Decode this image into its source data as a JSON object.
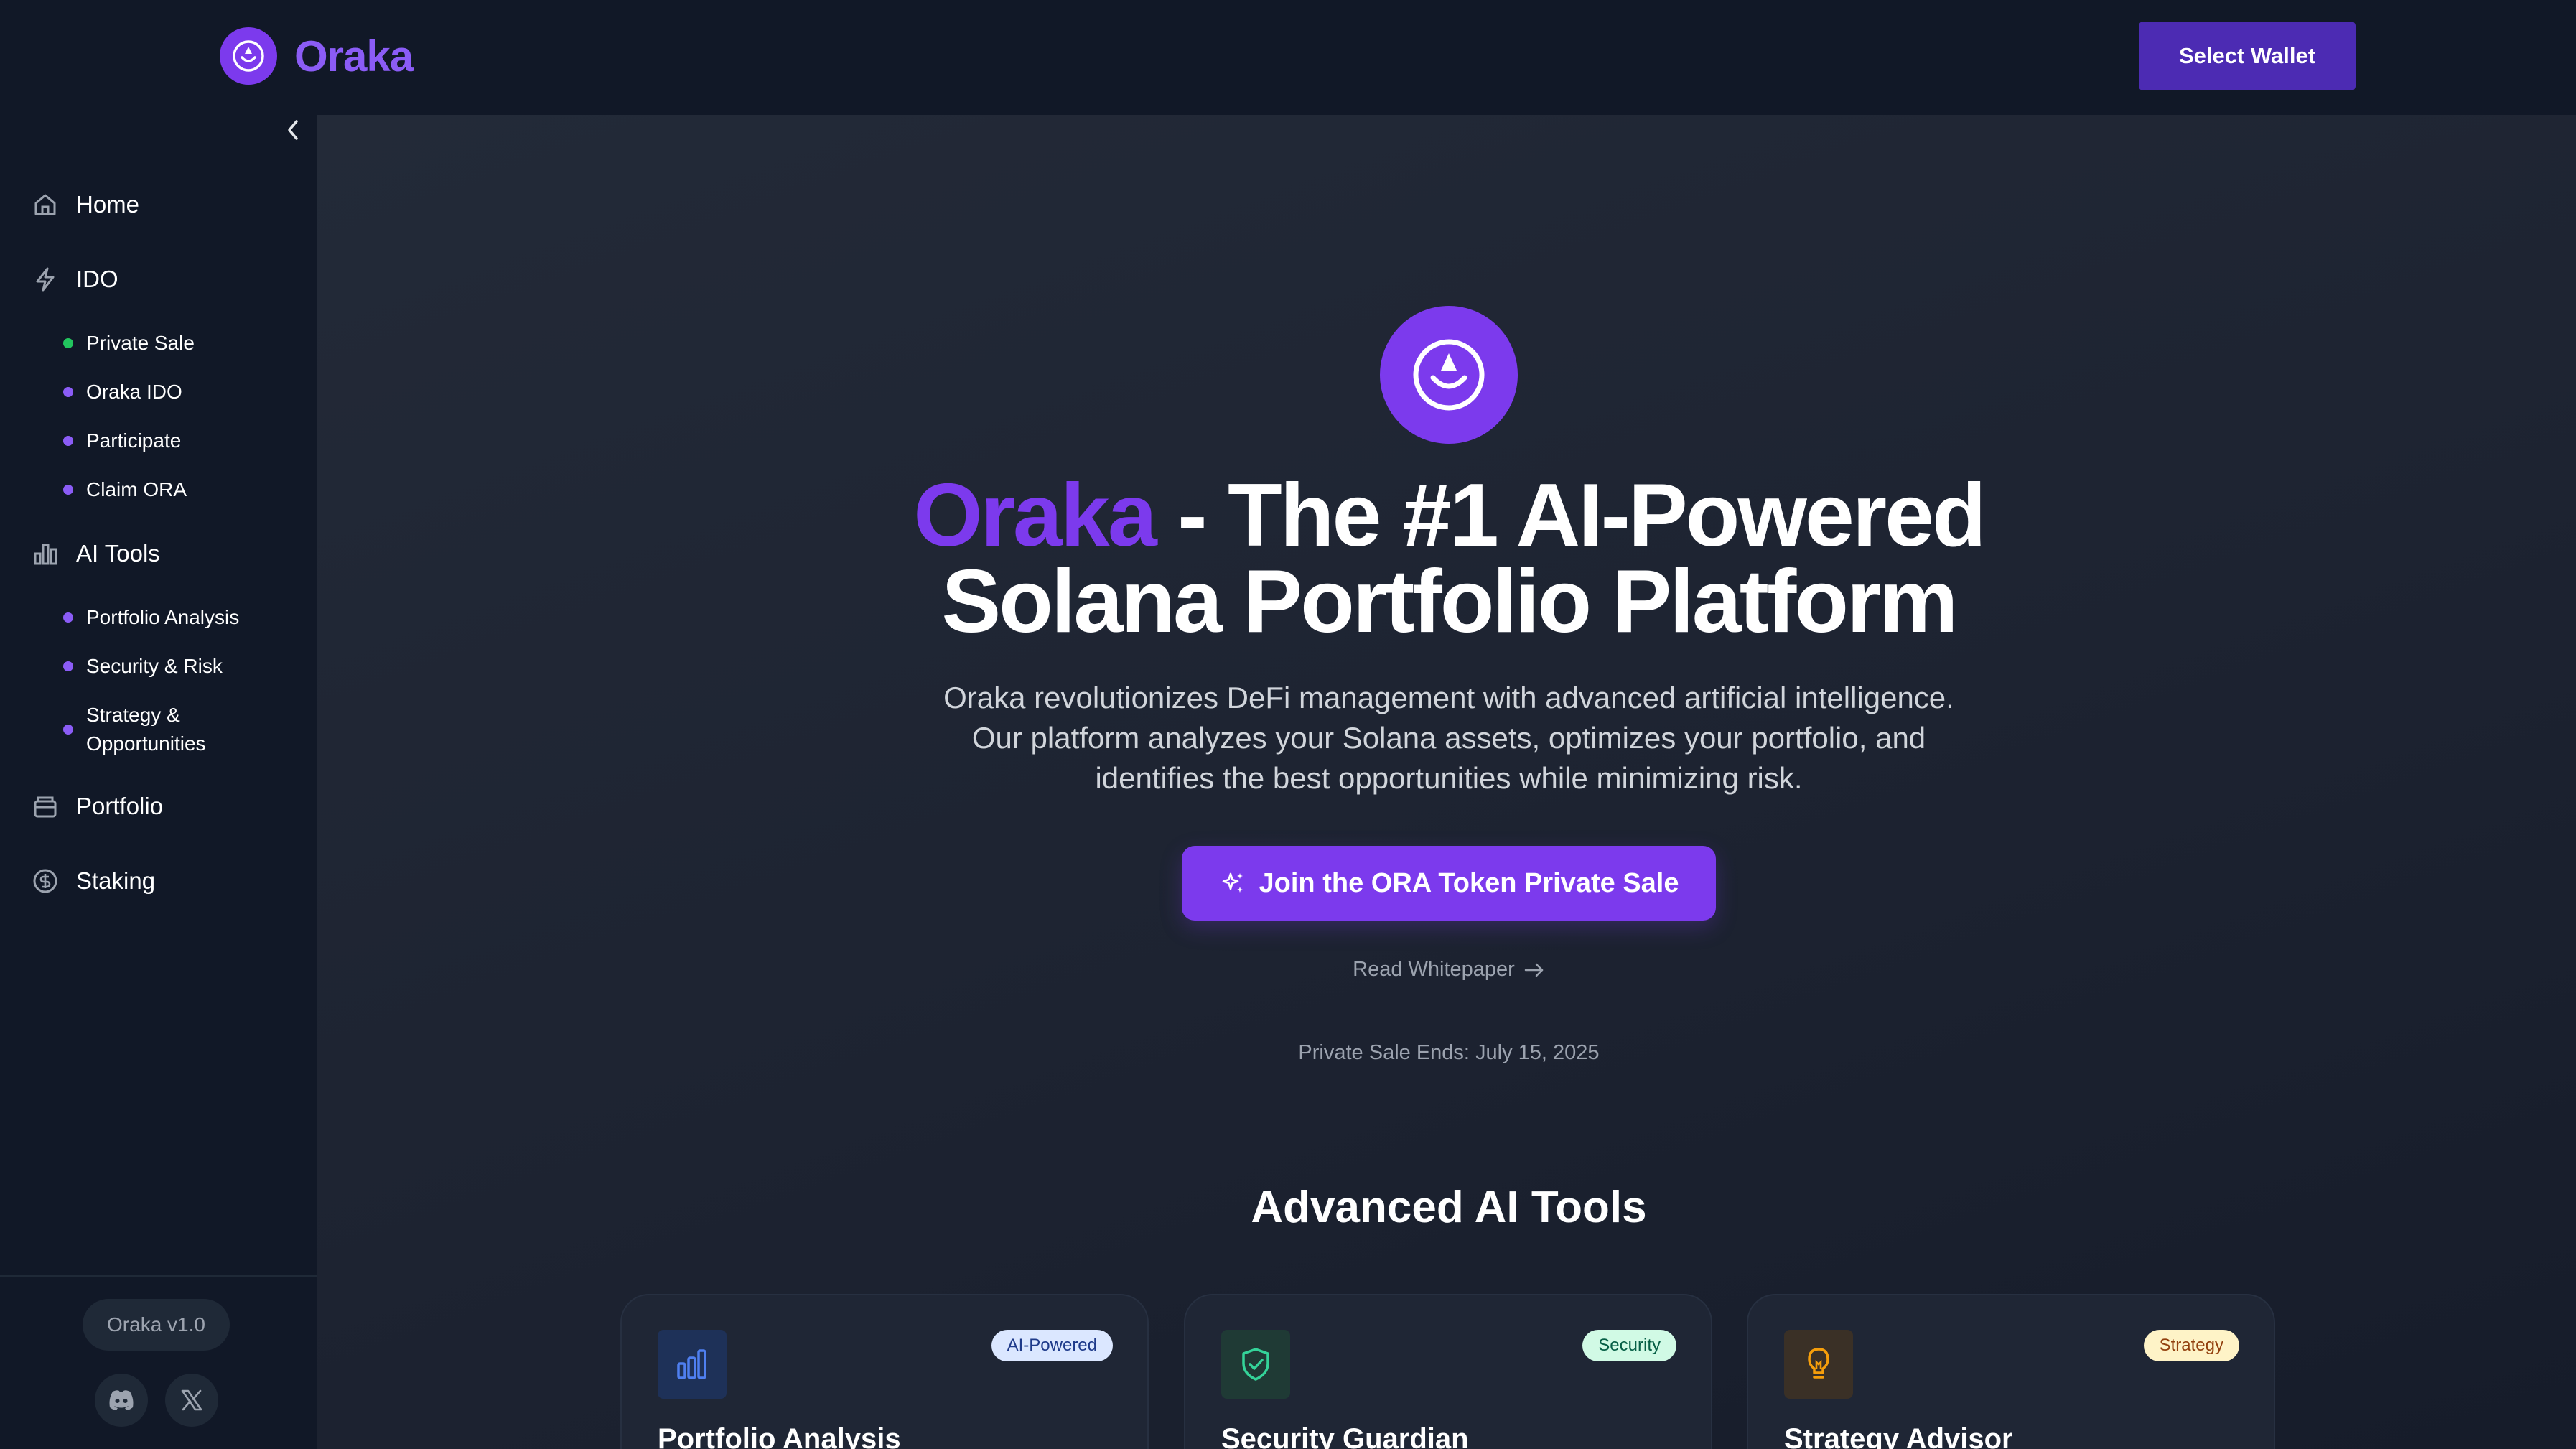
{
  "brand": {
    "name": "Oraka",
    "logo_icon": "oraka-logo-icon"
  },
  "header": {
    "wallet_button": "Select Wallet"
  },
  "sidebar": {
    "collapse_icon": "chevron-left-icon",
    "items": [
      {
        "label": "Home",
        "icon": "home-icon"
      },
      {
        "label": "IDO",
        "icon": "lightning-icon"
      },
      {
        "label": "AI Tools",
        "icon": "bar-chart-icon"
      },
      {
        "label": "Portfolio",
        "icon": "wallet-icon"
      },
      {
        "label": "Staking",
        "icon": "dollar-circle-icon"
      }
    ],
    "ido_sub": [
      {
        "label": "Private Sale",
        "dot_color": "#22c55e"
      },
      {
        "label": "Oraka IDO",
        "dot_color": "#8b5cf6"
      },
      {
        "label": "Participate",
        "dot_color": "#8b5cf6"
      },
      {
        "label": "Claim ORA",
        "dot_color": "#8b5cf6"
      }
    ],
    "ai_sub": [
      {
        "label": "Portfolio Analysis"
      },
      {
        "label": "Security & Risk"
      },
      {
        "label": "Strategy &",
        "label2": "Opportunities"
      }
    ],
    "version": "Oraka v1.0",
    "social": [
      "discord-icon",
      "x-icon"
    ]
  },
  "hero": {
    "title_accent": "Oraka",
    "title_line1_rest": " - The #1 AI-Powered",
    "title_line2": "Solana Portfolio Platform",
    "description": "Oraka revolutionizes DeFi management with advanced artificial intelligence. Our platform analyzes your Solana assets, optimizes your portfolio, and identifies the best opportunities while minimizing risk.",
    "cta": "Join the ORA Token Private Sale",
    "whitepaper": "Read Whitepaper",
    "sale_ends": "Private Sale Ends: July 15, 2025"
  },
  "tools": {
    "title": "Advanced AI Tools",
    "cards": [
      {
        "title": "Portfolio Analysis",
        "badge": "AI-Powered",
        "icon": "bar-chart-icon"
      },
      {
        "title": "Security Guardian",
        "badge": "Security",
        "icon": "shield-check-icon"
      },
      {
        "title": "Strategy Advisor",
        "badge": "Strategy",
        "icon": "lightbulb-icon"
      }
    ]
  },
  "colors": {
    "accent": "#7c3aed",
    "accent_light": "#8b5cf6",
    "sidebar_bg": "#111827",
    "main_bg": "#1d2331"
  }
}
